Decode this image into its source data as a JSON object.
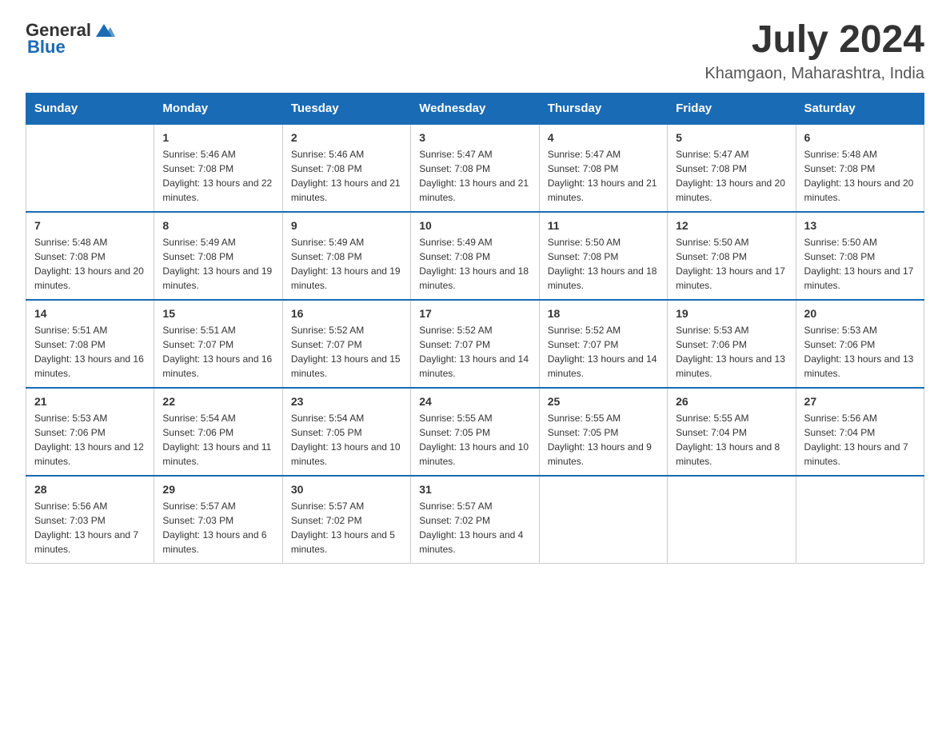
{
  "header": {
    "logo_general": "General",
    "logo_blue": "Blue",
    "month_year": "July 2024",
    "location": "Khamgaon, Maharashtra, India"
  },
  "days_of_week": [
    "Sunday",
    "Monday",
    "Tuesday",
    "Wednesday",
    "Thursday",
    "Friday",
    "Saturday"
  ],
  "weeks": [
    [
      {
        "day": "",
        "sunrise": "",
        "sunset": "",
        "daylight": ""
      },
      {
        "day": "1",
        "sunrise": "Sunrise: 5:46 AM",
        "sunset": "Sunset: 7:08 PM",
        "daylight": "Daylight: 13 hours and 22 minutes."
      },
      {
        "day": "2",
        "sunrise": "Sunrise: 5:46 AM",
        "sunset": "Sunset: 7:08 PM",
        "daylight": "Daylight: 13 hours and 21 minutes."
      },
      {
        "day": "3",
        "sunrise": "Sunrise: 5:47 AM",
        "sunset": "Sunset: 7:08 PM",
        "daylight": "Daylight: 13 hours and 21 minutes."
      },
      {
        "day": "4",
        "sunrise": "Sunrise: 5:47 AM",
        "sunset": "Sunset: 7:08 PM",
        "daylight": "Daylight: 13 hours and 21 minutes."
      },
      {
        "day": "5",
        "sunrise": "Sunrise: 5:47 AM",
        "sunset": "Sunset: 7:08 PM",
        "daylight": "Daylight: 13 hours and 20 minutes."
      },
      {
        "day": "6",
        "sunrise": "Sunrise: 5:48 AM",
        "sunset": "Sunset: 7:08 PM",
        "daylight": "Daylight: 13 hours and 20 minutes."
      }
    ],
    [
      {
        "day": "7",
        "sunrise": "Sunrise: 5:48 AM",
        "sunset": "Sunset: 7:08 PM",
        "daylight": "Daylight: 13 hours and 20 minutes."
      },
      {
        "day": "8",
        "sunrise": "Sunrise: 5:49 AM",
        "sunset": "Sunset: 7:08 PM",
        "daylight": "Daylight: 13 hours and 19 minutes."
      },
      {
        "day": "9",
        "sunrise": "Sunrise: 5:49 AM",
        "sunset": "Sunset: 7:08 PM",
        "daylight": "Daylight: 13 hours and 19 minutes."
      },
      {
        "day": "10",
        "sunrise": "Sunrise: 5:49 AM",
        "sunset": "Sunset: 7:08 PM",
        "daylight": "Daylight: 13 hours and 18 minutes."
      },
      {
        "day": "11",
        "sunrise": "Sunrise: 5:50 AM",
        "sunset": "Sunset: 7:08 PM",
        "daylight": "Daylight: 13 hours and 18 minutes."
      },
      {
        "day": "12",
        "sunrise": "Sunrise: 5:50 AM",
        "sunset": "Sunset: 7:08 PM",
        "daylight": "Daylight: 13 hours and 17 minutes."
      },
      {
        "day": "13",
        "sunrise": "Sunrise: 5:50 AM",
        "sunset": "Sunset: 7:08 PM",
        "daylight": "Daylight: 13 hours and 17 minutes."
      }
    ],
    [
      {
        "day": "14",
        "sunrise": "Sunrise: 5:51 AM",
        "sunset": "Sunset: 7:08 PM",
        "daylight": "Daylight: 13 hours and 16 minutes."
      },
      {
        "day": "15",
        "sunrise": "Sunrise: 5:51 AM",
        "sunset": "Sunset: 7:07 PM",
        "daylight": "Daylight: 13 hours and 16 minutes."
      },
      {
        "day": "16",
        "sunrise": "Sunrise: 5:52 AM",
        "sunset": "Sunset: 7:07 PM",
        "daylight": "Daylight: 13 hours and 15 minutes."
      },
      {
        "day": "17",
        "sunrise": "Sunrise: 5:52 AM",
        "sunset": "Sunset: 7:07 PM",
        "daylight": "Daylight: 13 hours and 14 minutes."
      },
      {
        "day": "18",
        "sunrise": "Sunrise: 5:52 AM",
        "sunset": "Sunset: 7:07 PM",
        "daylight": "Daylight: 13 hours and 14 minutes."
      },
      {
        "day": "19",
        "sunrise": "Sunrise: 5:53 AM",
        "sunset": "Sunset: 7:06 PM",
        "daylight": "Daylight: 13 hours and 13 minutes."
      },
      {
        "day": "20",
        "sunrise": "Sunrise: 5:53 AM",
        "sunset": "Sunset: 7:06 PM",
        "daylight": "Daylight: 13 hours and 13 minutes."
      }
    ],
    [
      {
        "day": "21",
        "sunrise": "Sunrise: 5:53 AM",
        "sunset": "Sunset: 7:06 PM",
        "daylight": "Daylight: 13 hours and 12 minutes."
      },
      {
        "day": "22",
        "sunrise": "Sunrise: 5:54 AM",
        "sunset": "Sunset: 7:06 PM",
        "daylight": "Daylight: 13 hours and 11 minutes."
      },
      {
        "day": "23",
        "sunrise": "Sunrise: 5:54 AM",
        "sunset": "Sunset: 7:05 PM",
        "daylight": "Daylight: 13 hours and 10 minutes."
      },
      {
        "day": "24",
        "sunrise": "Sunrise: 5:55 AM",
        "sunset": "Sunset: 7:05 PM",
        "daylight": "Daylight: 13 hours and 10 minutes."
      },
      {
        "day": "25",
        "sunrise": "Sunrise: 5:55 AM",
        "sunset": "Sunset: 7:05 PM",
        "daylight": "Daylight: 13 hours and 9 minutes."
      },
      {
        "day": "26",
        "sunrise": "Sunrise: 5:55 AM",
        "sunset": "Sunset: 7:04 PM",
        "daylight": "Daylight: 13 hours and 8 minutes."
      },
      {
        "day": "27",
        "sunrise": "Sunrise: 5:56 AM",
        "sunset": "Sunset: 7:04 PM",
        "daylight": "Daylight: 13 hours and 7 minutes."
      }
    ],
    [
      {
        "day": "28",
        "sunrise": "Sunrise: 5:56 AM",
        "sunset": "Sunset: 7:03 PM",
        "daylight": "Daylight: 13 hours and 7 minutes."
      },
      {
        "day": "29",
        "sunrise": "Sunrise: 5:57 AM",
        "sunset": "Sunset: 7:03 PM",
        "daylight": "Daylight: 13 hours and 6 minutes."
      },
      {
        "day": "30",
        "sunrise": "Sunrise: 5:57 AM",
        "sunset": "Sunset: 7:02 PM",
        "daylight": "Daylight: 13 hours and 5 minutes."
      },
      {
        "day": "31",
        "sunrise": "Sunrise: 5:57 AM",
        "sunset": "Sunset: 7:02 PM",
        "daylight": "Daylight: 13 hours and 4 minutes."
      },
      {
        "day": "",
        "sunrise": "",
        "sunset": "",
        "daylight": ""
      },
      {
        "day": "",
        "sunrise": "",
        "sunset": "",
        "daylight": ""
      },
      {
        "day": "",
        "sunrise": "",
        "sunset": "",
        "daylight": ""
      }
    ]
  ]
}
